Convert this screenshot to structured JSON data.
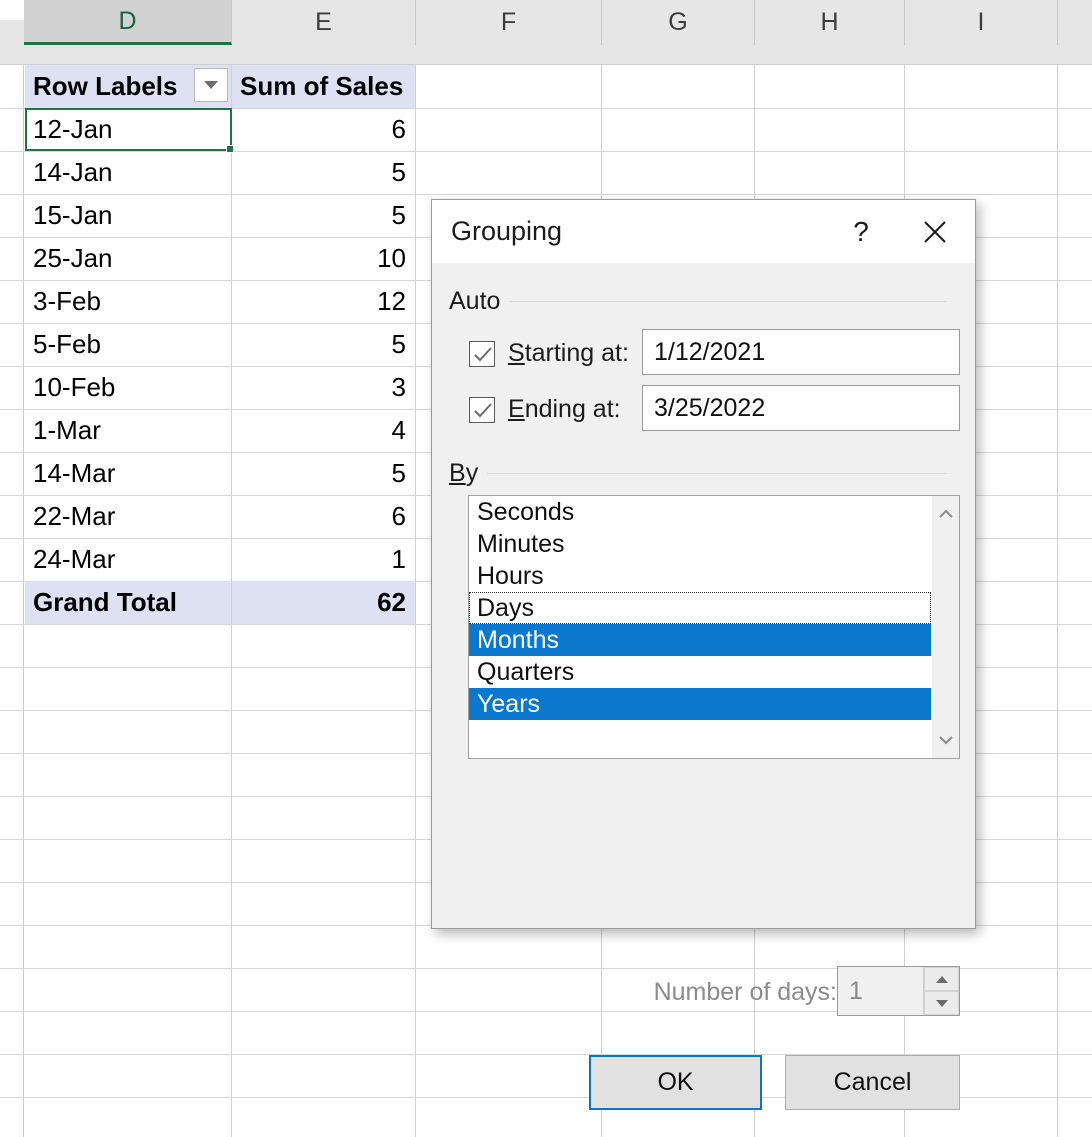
{
  "spreadsheet": {
    "columns": [
      "D",
      "E",
      "F",
      "G",
      "H",
      "I"
    ],
    "active_column": "D",
    "pivot": {
      "header_label": "Row Labels",
      "header_value": "Sum of Sales",
      "filter_icon": "filter-dropdown-icon",
      "rows": [
        {
          "label": "12-Jan",
          "value": "6"
        },
        {
          "label": "14-Jan",
          "value": "5"
        },
        {
          "label": "15-Jan",
          "value": "5"
        },
        {
          "label": "25-Jan",
          "value": "10"
        },
        {
          "label": "3-Feb",
          "value": "12"
        },
        {
          "label": "5-Feb",
          "value": "5"
        },
        {
          "label": "10-Feb",
          "value": "3"
        },
        {
          "label": "1-Mar",
          "value": "4"
        },
        {
          "label": "14-Mar",
          "value": "5"
        },
        {
          "label": "22-Mar",
          "value": "6"
        },
        {
          "label": "24-Mar",
          "value": "1"
        }
      ],
      "total_label": "Grand Total",
      "total_value": "62",
      "selected_cell_text": "12-Jan"
    }
  },
  "dialog": {
    "title": "Grouping",
    "help_glyph": "?",
    "close_icon": "close-icon",
    "auto": {
      "group_label": "Auto",
      "starting": {
        "label_pre": "S",
        "label_rest": "tarting at:",
        "checked": true,
        "value": "1/12/2021"
      },
      "ending": {
        "label_pre": "E",
        "label_rest": "nding at:",
        "checked": true,
        "value": "3/25/2022"
      }
    },
    "by": {
      "group_label_pre": "B",
      "group_label_rest": "y",
      "options": [
        {
          "label": "Seconds",
          "selected": false,
          "focused": false
        },
        {
          "label": "Minutes",
          "selected": false,
          "focused": false
        },
        {
          "label": "Hours",
          "selected": false,
          "focused": false
        },
        {
          "label": "Days",
          "selected": false,
          "focused": true
        },
        {
          "label": "Months",
          "selected": true,
          "focused": false
        },
        {
          "label": "Quarters",
          "selected": false,
          "focused": false
        },
        {
          "label": "Years",
          "selected": true,
          "focused": false
        }
      ],
      "scroll_up_icon": "chevron-up-icon",
      "scroll_down_icon": "chevron-down-icon"
    },
    "number_of_days": {
      "label": "Number of days:",
      "value": "1",
      "disabled": true,
      "up_icon": "spinner-up-icon",
      "down_icon": "spinner-down-icon"
    },
    "buttons": {
      "ok": "OK",
      "cancel": "Cancel"
    }
  },
  "colors": {
    "excel_green": "#217346",
    "pivot_header_bg": "#dde1f1",
    "selection_blue": "#0b78d0",
    "default_button_border": "#0b76c6"
  }
}
